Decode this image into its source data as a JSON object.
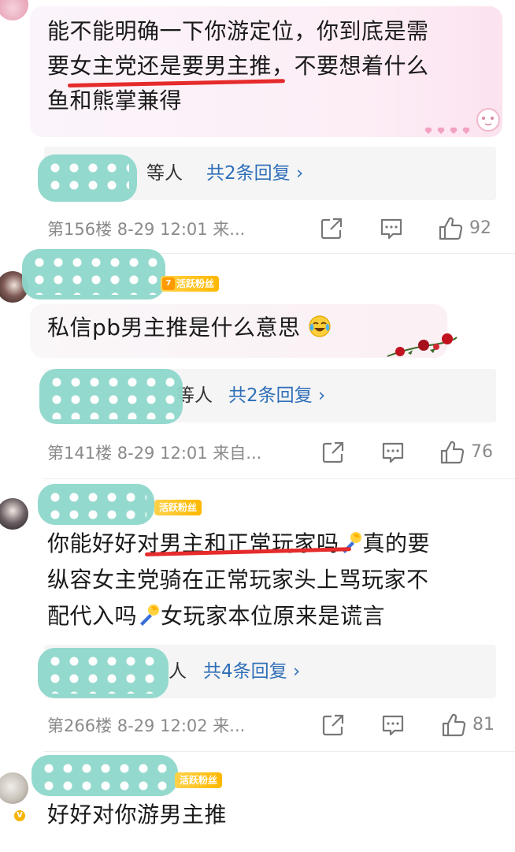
{
  "comments": [
    {
      "text_lines": [
        "能不能明确一下你游定位，你到底是需",
        "要女主党还是要男主推，不要想着什么",
        "鱼和熊掌兼得"
      ],
      "reply_prefix": "等人",
      "reply_link": "共2条回复 ›",
      "meta": "第156楼 8-29 12:01 来...",
      "likes": "92"
    },
    {
      "fan_badge_level": "7",
      "fan_badge": "活跃粉丝",
      "text": "私信pb男主推是什么意思",
      "reply_prefix": "等人",
      "reply_link": "共2条回复 ›",
      "meta": "第141楼 8-29 12:01 来自...",
      "likes": "76"
    },
    {
      "fan_badge": "活跃粉丝",
      "text_line1_a": "你能好好对男主和正常玩家吗",
      "text_line1_b": "真的要",
      "text_line2": "纵容女主党骑在正常玩家头上骂玩家不",
      "text_line3_a": "配代入吗",
      "text_line3_b": "女玩家本位原来是谎言",
      "reply_prefix": "人",
      "reply_link": "共4条回复 ›",
      "meta": "第266楼 8-29 12:02 来...",
      "likes": "81"
    },
    {
      "fan_badge": "活跃粉丝",
      "text": "好好对你游男主推"
    }
  ],
  "colors": {
    "link": "#2f6fb8",
    "underline": "#e52b2b",
    "badge": "#ffb800",
    "blur": "#8fd8cb"
  },
  "icons": [
    "share-icon",
    "comment-icon",
    "like-icon",
    "laugh-cry-emoji",
    "torch-emoji",
    "roses-decoration",
    "verified-badge"
  ]
}
